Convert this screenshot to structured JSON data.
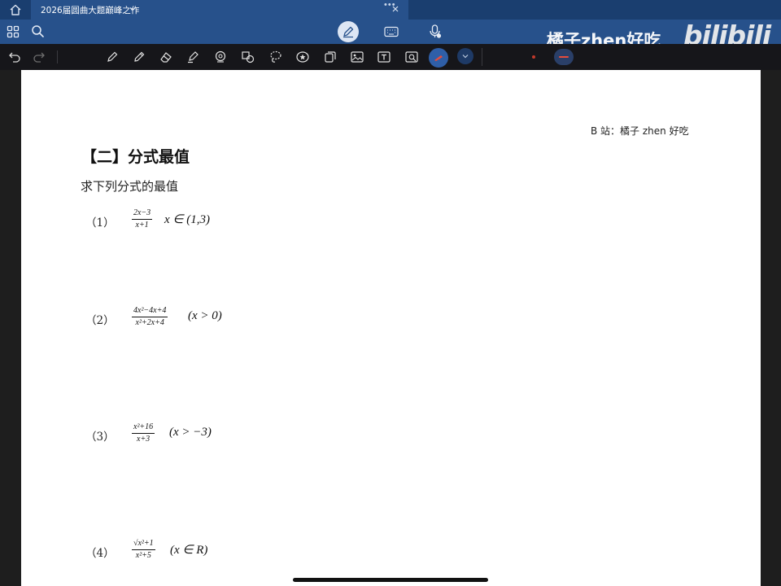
{
  "tabbar": {
    "document_title": "2026届圆曲大题巅峰之作",
    "more_label": "•••"
  },
  "navbar": {
    "icons": [
      "home-icon",
      "grid-icon",
      "search-icon",
      "pen-mode-icon",
      "keyboard-icon",
      "mic-icon"
    ]
  },
  "toolbar": {
    "icons": [
      "undo-icon",
      "redo-icon",
      "pen-icon",
      "pencil-icon",
      "eraser-icon",
      "highlighter-icon",
      "shape-icon",
      "text-shape-icon",
      "lasso-icon",
      "sticker-icon",
      "page-copy-icon",
      "image-icon",
      "text-box-icon",
      "camera-scan-icon",
      "color-picker-icon",
      "chevron-down-icon"
    ],
    "accent_color": "#27518b",
    "active_color": "#c0392b"
  },
  "watermark": {
    "uploader": "橘子zhen好吃",
    "logo": "bilibili"
  },
  "page": {
    "author": "B 站：橘子 zhen 好吃",
    "heading": "【二】分式最值",
    "instruction": "求下列分式的最值",
    "problems": [
      {
        "number": "（1）",
        "numerator": "2x−3",
        "denominator": "x+1",
        "condition": "x ∈ (1,3)"
      },
      {
        "number": "（2）",
        "numerator": "4x²−4x+4",
        "denominator": "x²+2x+4",
        "condition": "(x > 0)"
      },
      {
        "number": "（3）",
        "numerator": "x²+16",
        "denominator": "x+3",
        "condition": "(x > −3)"
      },
      {
        "number": "（4）",
        "numerator": "√x²+1",
        "denominator": "x²+5",
        "condition": "(x ∈ R)"
      }
    ]
  }
}
